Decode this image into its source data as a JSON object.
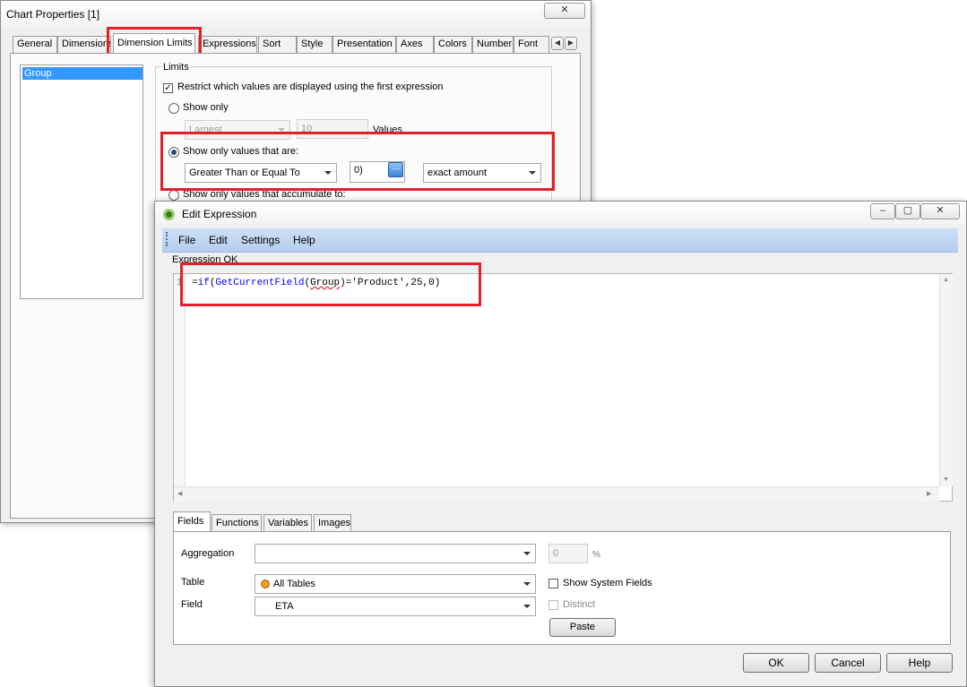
{
  "chart_properties": {
    "title": "Chart Properties [1]",
    "tabs": [
      "General",
      "Dimensions",
      "Dimension Limits",
      "Expressions",
      "Sort",
      "Style",
      "Presentation",
      "Axes",
      "Colors",
      "Number",
      "Font"
    ],
    "active_tab": "Dimension Limits",
    "dimension_list": [
      "Group"
    ],
    "limits": {
      "group_label": "Limits",
      "restrict_label": "Restrict which values are displayed using the first expression",
      "restrict_checked": true,
      "show_only_label": "Show only",
      "show_only_combo": "Largest",
      "show_only_count": "10",
      "values_label": "Values",
      "show_values_label": "Show only values that are:",
      "condition_combo": "Greater Than or Equal To",
      "expression_value": "0)",
      "expr_button": "...",
      "amount_combo": "exact amount",
      "accumulate_label": "Show only values that accumulate to:"
    }
  },
  "edit_expression": {
    "title": "Edit Expression",
    "menu": [
      "File",
      "Edit",
      "Settings",
      "Help"
    ],
    "status": "Expression OK",
    "line_number": "1",
    "code": {
      "eq": "=",
      "if_kw": "if",
      "paren_open": "(",
      "func": "GetCurrentField",
      "arg_open": "(",
      "arg": "Group",
      "arg_close": ")",
      "rest": "='Product',25,0)"
    },
    "bottom_tabs": [
      "Fields",
      "Functions",
      "Variables",
      "Images"
    ],
    "active_bottom_tab": "Fields",
    "fields": {
      "aggregation_label": "Aggregation",
      "aggregation_value": "",
      "percent_value": "0",
      "percent_sign": "%",
      "table_label": "Table",
      "table_value": "All Tables",
      "field_label": "Field",
      "field_value": "ETA",
      "show_system_fields": "Show System Fields",
      "distinct": "Distinct",
      "paste": "Paste"
    },
    "buttons": {
      "ok": "OK",
      "cancel": "Cancel",
      "help": "Help"
    }
  },
  "colors": {
    "highlight_red": "#e0212b",
    "selection_blue": "#3399ff",
    "code_blue": "#0000ff"
  }
}
